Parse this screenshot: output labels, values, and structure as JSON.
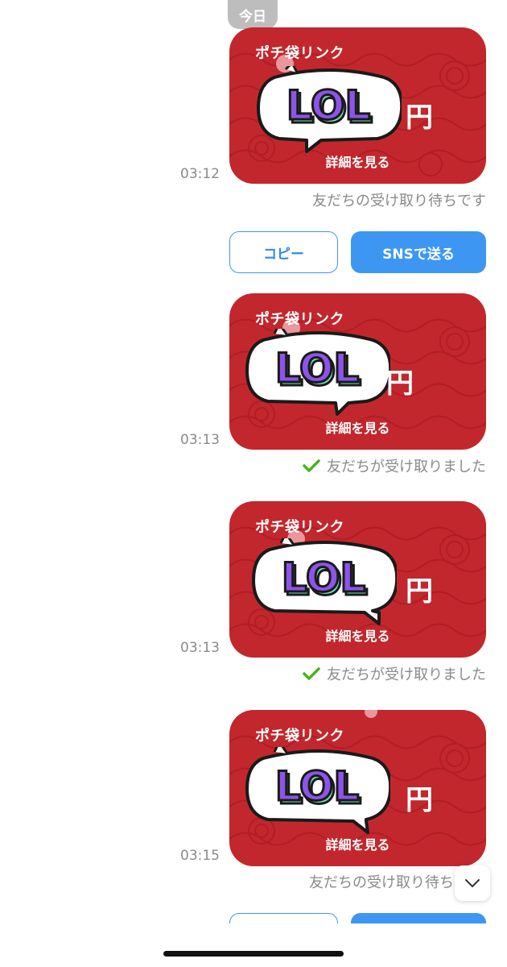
{
  "date_label": "今日",
  "cards": [
    {
      "title": "ポチ袋リンク",
      "sticker_text": "LOL",
      "yen": "円",
      "detail": "詳細を見る",
      "time": "03:12",
      "status": "友だちの受け取り待ちです",
      "status_icon": "",
      "received": false
    },
    {
      "title": "ポチ袋リンク",
      "sticker_text": "LOL",
      "yen": "円",
      "detail": "詳細を見る",
      "time": "03:13",
      "status": "友だちが受け取りました",
      "status_icon": "check-icon",
      "received": true
    },
    {
      "title": "ポチ袋リンク",
      "sticker_text": "LOL",
      "yen": "円",
      "detail": "詳細を見る",
      "time": "03:13",
      "status": "友だちが受け取りました",
      "status_icon": "check-icon",
      "received": true
    },
    {
      "title": "ポチ袋リンク",
      "sticker_text": "LOL",
      "yen": "円",
      "detail": "詳細を見る",
      "time": "03:15",
      "status": "友だちの受け取り待ち",
      "status_icon": "",
      "received": false
    }
  ],
  "actions": {
    "copy_label": "コピー",
    "sns_label": "SNSで送る"
  },
  "icons": {
    "scroll_down": "chevron-down-icon"
  },
  "colors": {
    "card_red": "#c2272d",
    "accent_blue": "#3d97f2",
    "check_green": "#4cb31a",
    "sticker_purple": "#8c55e8",
    "sticker_mint": "#6fe0b3"
  }
}
